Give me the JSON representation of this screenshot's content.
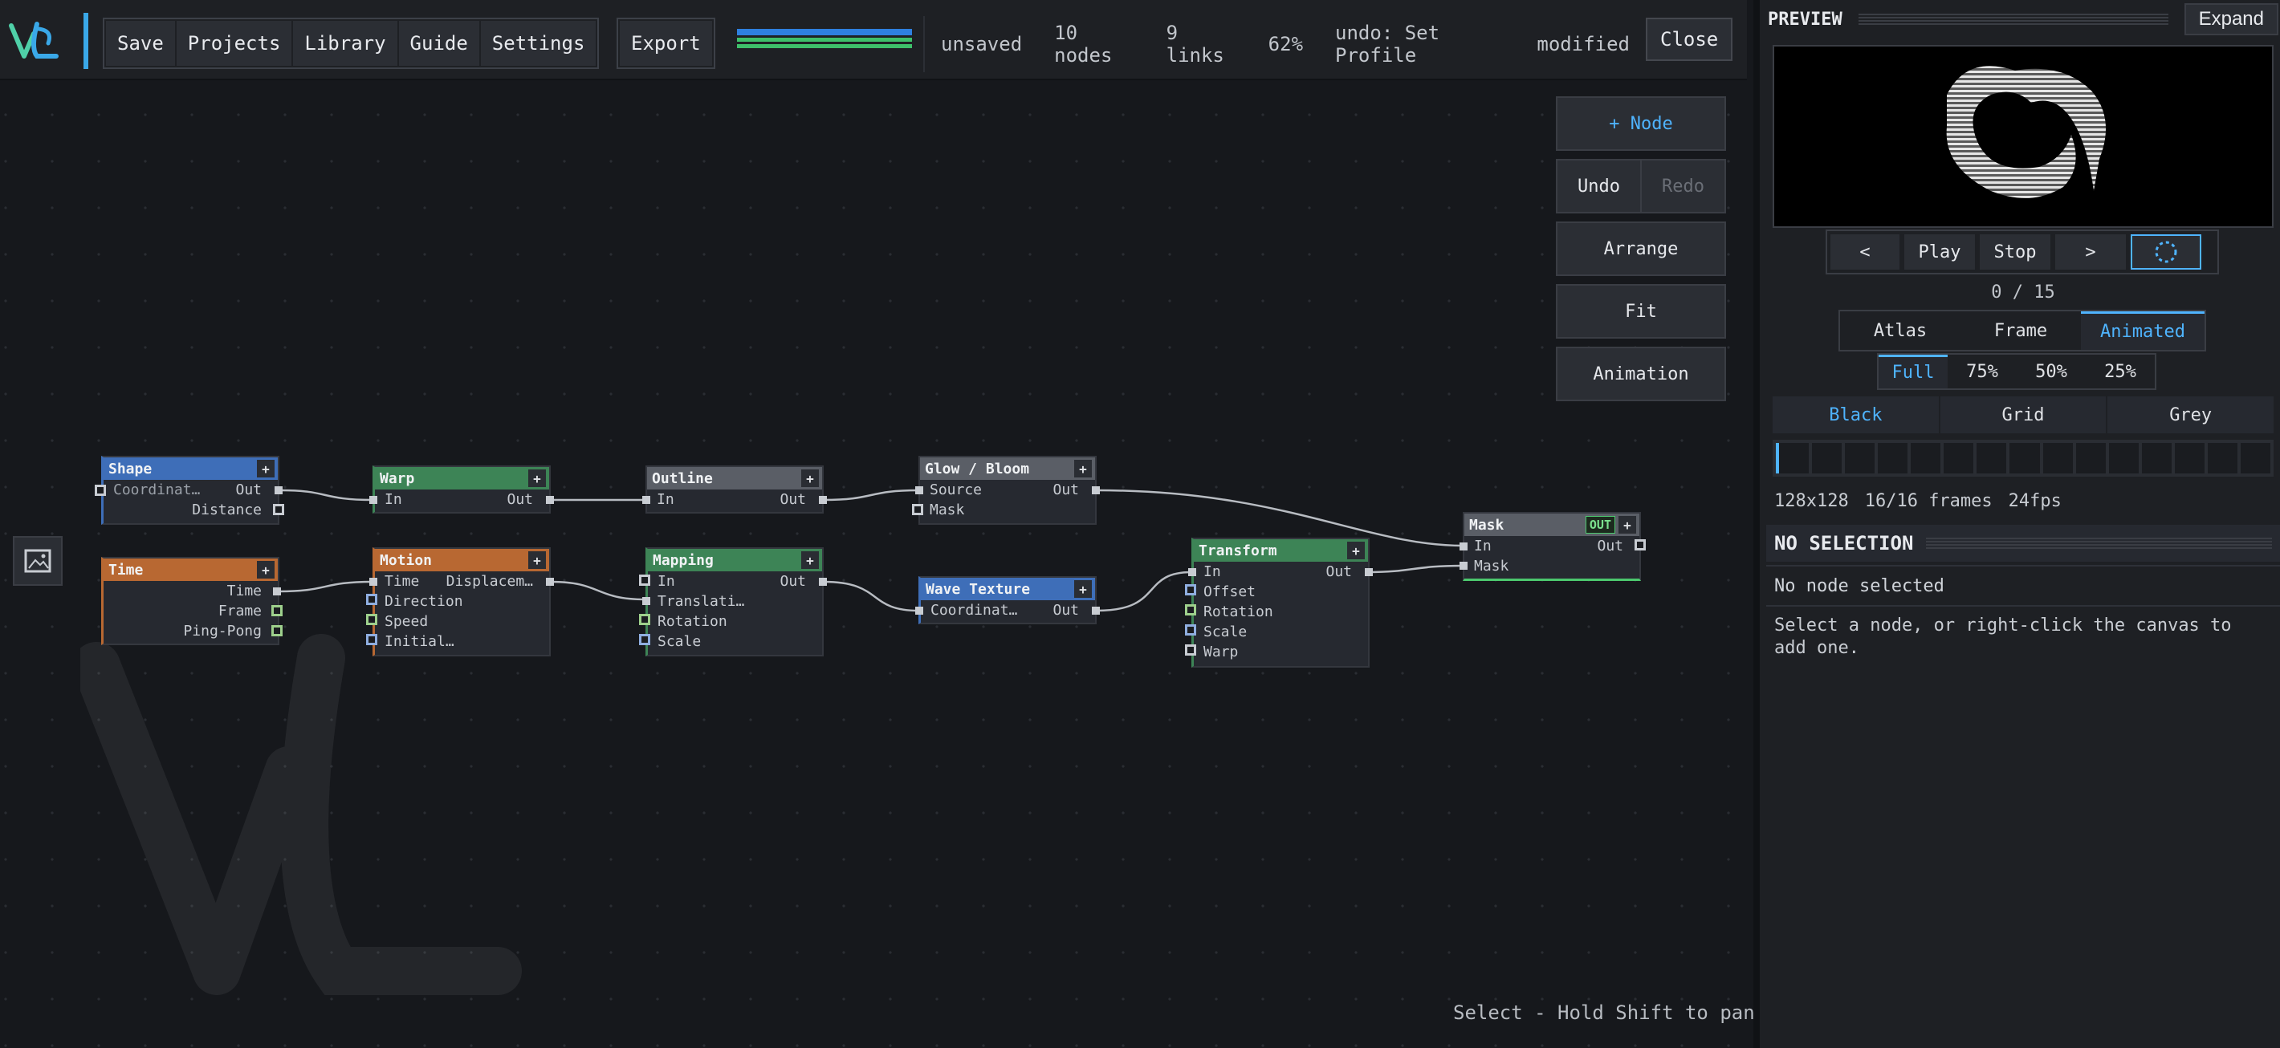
{
  "toolbar": {
    "save": "Save",
    "projects": "Projects",
    "library": "Library",
    "guide": "Guide",
    "settings": "Settings",
    "export": "Export",
    "close": "Close"
  },
  "status": {
    "saved": "unsaved",
    "nodes": "10 nodes",
    "links": "9 links",
    "zoom": "62%",
    "undo": "undo: Set Profile",
    "state": "modified"
  },
  "canvas_buttons": {
    "add_node": "+ Node",
    "undo": "Undo",
    "redo": "Redo",
    "arrange": "Arrange",
    "fit": "Fit",
    "animation": "Animation"
  },
  "canvas_hint": "Select - Hold Shift to pan",
  "nodes": {
    "shape": {
      "title": "Shape",
      "in1": "Coordinat…",
      "out1": "Out",
      "out2": "Distance"
    },
    "warp": {
      "title": "Warp",
      "in1": "In",
      "out1": "Out"
    },
    "outline": {
      "title": "Outline",
      "in1": "In",
      "out1": "Out"
    },
    "glow": {
      "title": "Glow / Bloom",
      "in1": "Source",
      "in2": "Mask",
      "out1": "Out"
    },
    "time": {
      "title": "Time",
      "out1": "Time",
      "out2": "Frame",
      "out3": "Ping-Pong"
    },
    "motion": {
      "title": "Motion",
      "in1": "Time",
      "in2": "Direction",
      "in3": "Speed",
      "in4": "Initial…",
      "out1": "Displacem…"
    },
    "mapping": {
      "title": "Mapping",
      "in1": "In",
      "in2": "Translati…",
      "in3": "Rotation",
      "in4": "Scale",
      "out1": "Out"
    },
    "wave": {
      "title": "Wave Texture",
      "in1": "Coordinat…",
      "out1": "Out"
    },
    "transform": {
      "title": "Transform",
      "in1": "In",
      "in2": "Offset",
      "in3": "Rotation",
      "in4": "Scale",
      "in5": "Warp",
      "out1": "Out"
    },
    "mask": {
      "title": "Mask",
      "badge": "OUT",
      "in1": "In",
      "in2": "Mask",
      "out1": "Out"
    }
  },
  "panel": {
    "title": "PREVIEW",
    "expand": "Expand",
    "prev": "<",
    "play": "Play",
    "stop": "Stop",
    "next": ">",
    "frame_counter": "0 / 15",
    "view_modes": [
      "Atlas",
      "Frame",
      "Animated"
    ],
    "active_view": "Animated",
    "scales": [
      "Full",
      "75%",
      "50%",
      "25%"
    ],
    "active_scale": "Full",
    "backgrounds": [
      "Black",
      "Grid",
      "Grey"
    ],
    "active_background": "Black",
    "frames_total": 15,
    "current_frame": 0,
    "resolution": "128x128",
    "frames": "16/16 frames",
    "fps": "24fps",
    "selection_title": "NO SELECTION",
    "selection_value": "No node selected",
    "selection_hint": "Select a node, or right-click the canvas to add one."
  },
  "colors": {
    "accent": "#4fb4ff",
    "brand": "#3aa8e8",
    "node_blue": "#3e6eb8",
    "node_green": "#3d8456",
    "node_grey": "#5a5e66",
    "node_orange": "#b86832"
  }
}
